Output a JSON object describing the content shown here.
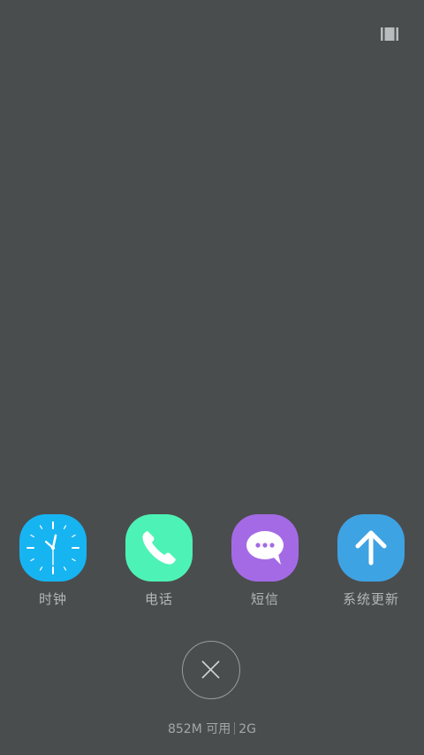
{
  "top_bar": {
    "view_toggle_icon": "list-view-icon"
  },
  "recent_apps": [
    {
      "label": "时钟",
      "icon": "clock-icon",
      "color": "#17b4f2"
    },
    {
      "label": "电话",
      "icon": "phone-icon",
      "color": "#4df3b6"
    },
    {
      "label": "短信",
      "icon": "message-icon",
      "color": "#a46ae6"
    },
    {
      "label": "系统更新",
      "icon": "arrow-up-icon",
      "color": "#3ea3e3"
    }
  ],
  "close_button": {
    "icon": "close-icon"
  },
  "memory": {
    "available": "852M 可用",
    "total": "2G"
  },
  "colors": {
    "background": "#4a4d4e",
    "label_text": "#b3b6b8"
  }
}
